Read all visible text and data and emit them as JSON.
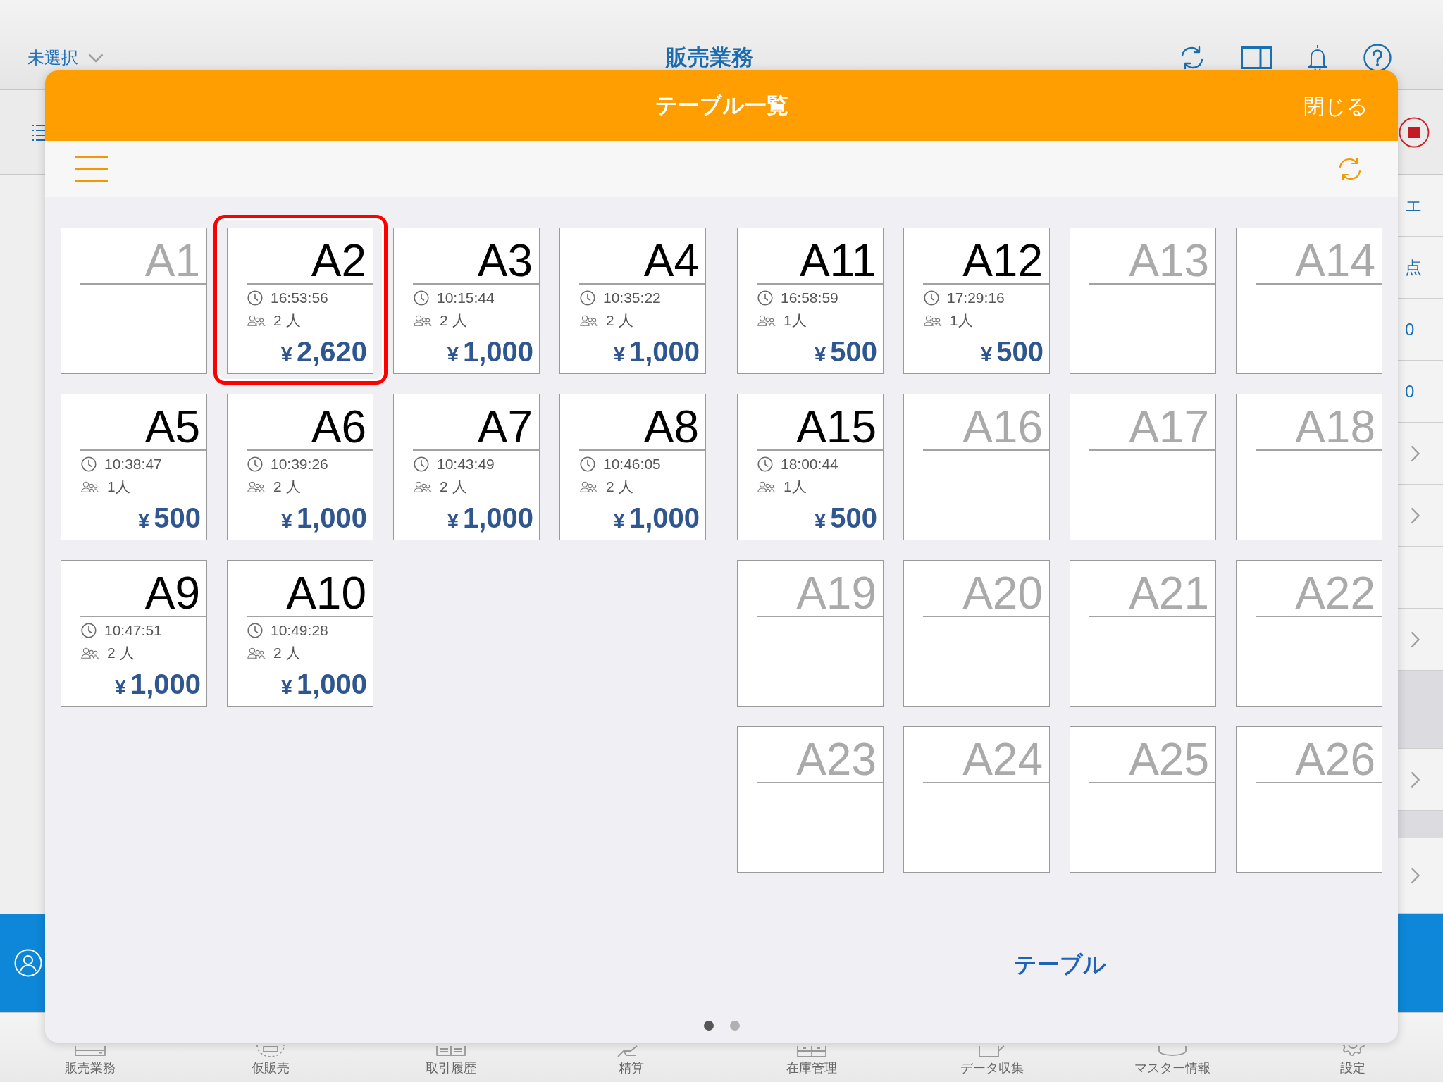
{
  "app": {
    "selector": "未選択",
    "title": "販売業務"
  },
  "side_panel": [
    {
      "kind": "text",
      "text": "エ"
    },
    {
      "kind": "text",
      "text": "点"
    },
    {
      "kind": "text",
      "text": "0"
    },
    {
      "kind": "text",
      "text": "0"
    },
    {
      "kind": "chevron"
    },
    {
      "kind": "chevron"
    },
    {
      "kind": "empty"
    },
    {
      "kind": "chevron"
    },
    {
      "kind": "header"
    },
    {
      "kind": "chevron"
    },
    {
      "kind": "gap"
    },
    {
      "kind": "chevron"
    }
  ],
  "tab_bar": [
    {
      "label": "販売業務"
    },
    {
      "label": "仮販売"
    },
    {
      "label": "取引履歴"
    },
    {
      "label": "精算"
    },
    {
      "label": "在庫管理"
    },
    {
      "label": "データ収集"
    },
    {
      "label": "マスター情報"
    },
    {
      "label": "設定"
    }
  ],
  "modal": {
    "title": "テーブル一覧",
    "close": "閉じる",
    "sections": [
      {
        "tables": [
          {
            "name": "A1",
            "occupied": false,
            "selected": false
          },
          {
            "name": "A2",
            "occupied": true,
            "selected": true,
            "time": "16:53:56",
            "guests": "2 人",
            "currency": "¥",
            "amount": "2,620"
          },
          {
            "name": "A3",
            "occupied": true,
            "selected": false,
            "time": "10:15:44",
            "guests": "2 人",
            "currency": "¥",
            "amount": "1,000"
          },
          {
            "name": "A4",
            "occupied": true,
            "selected": false,
            "time": "10:35:22",
            "guests": "2 人",
            "currency": "¥",
            "amount": "1,000"
          },
          {
            "name": "A5",
            "occupied": true,
            "selected": false,
            "time": "10:38:47",
            "guests": "1人",
            "currency": "¥",
            "amount": "500"
          },
          {
            "name": "A6",
            "occupied": true,
            "selected": false,
            "time": "10:39:26",
            "guests": "2 人",
            "currency": "¥",
            "amount": "1,000"
          },
          {
            "name": "A7",
            "occupied": true,
            "selected": false,
            "time": "10:43:49",
            "guests": "2 人",
            "currency": "¥",
            "amount": "1,000"
          },
          {
            "name": "A8",
            "occupied": true,
            "selected": false,
            "time": "10:46:05",
            "guests": "2 人",
            "currency": "¥",
            "amount": "1,000"
          },
          {
            "name": "A9",
            "occupied": true,
            "selected": false,
            "time": "10:47:51",
            "guests": "2 人",
            "currency": "¥",
            "amount": "1,000"
          },
          {
            "name": "A10",
            "occupied": true,
            "selected": false,
            "time": "10:49:28",
            "guests": "2 人",
            "currency": "¥",
            "amount": "1,000"
          }
        ]
      },
      {
        "tables": [
          {
            "name": "A11",
            "occupied": true,
            "selected": false,
            "time": "16:58:59",
            "guests": "1人",
            "currency": "¥",
            "amount": "500"
          },
          {
            "name": "A12",
            "occupied": true,
            "selected": false,
            "time": "17:29:16",
            "guests": "1人",
            "currency": "¥",
            "amount": "500"
          },
          {
            "name": "A13",
            "occupied": false,
            "selected": false
          },
          {
            "name": "A14",
            "occupied": false,
            "selected": false
          },
          {
            "name": "A15",
            "occupied": true,
            "selected": false,
            "time": "18:00:44",
            "guests": "1人",
            "currency": "¥",
            "amount": "500"
          },
          {
            "name": "A16",
            "occupied": false,
            "selected": false
          },
          {
            "name": "A17",
            "occupied": false,
            "selected": false
          },
          {
            "name": "A18",
            "occupied": false,
            "selected": false
          },
          {
            "name": "A19",
            "occupied": false,
            "selected": false
          },
          {
            "name": "A20",
            "occupied": false,
            "selected": false
          },
          {
            "name": "A21",
            "occupied": false,
            "selected": false
          },
          {
            "name": "A22",
            "occupied": false,
            "selected": false
          },
          {
            "name": "A23",
            "occupied": false,
            "selected": false
          },
          {
            "name": "A24",
            "occupied": false,
            "selected": false
          },
          {
            "name": "A25",
            "occupied": false,
            "selected": false
          },
          {
            "name": "A26",
            "occupied": false,
            "selected": false
          }
        ],
        "caption": "テーブル"
      }
    ],
    "page_dots": [
      {
        "selected": true
      },
      {
        "selected": false
      }
    ]
  }
}
